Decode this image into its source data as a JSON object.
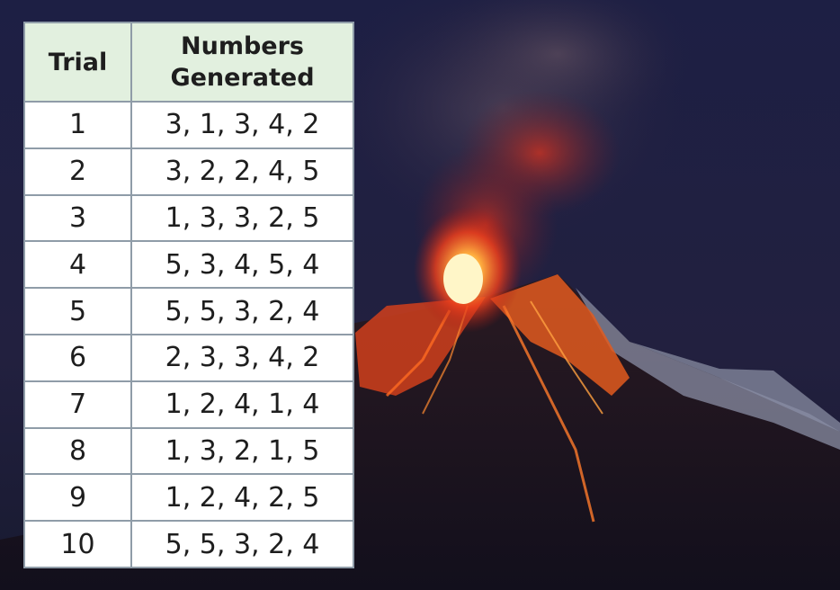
{
  "table": {
    "headers": [
      "Trial",
      "Numbers Generated"
    ],
    "rows": [
      {
        "trial": "1",
        "numbers": "3, 1, 3, 4, 2"
      },
      {
        "trial": "2",
        "numbers": "3, 2, 2, 4, 5"
      },
      {
        "trial": "3",
        "numbers": "1, 3, 3, 2, 5"
      },
      {
        "trial": "4",
        "numbers": "5, 3, 4, 5, 4"
      },
      {
        "trial": "5",
        "numbers": "5, 5, 3, 2, 4"
      },
      {
        "trial": "6",
        "numbers": "2, 3, 3, 4, 2"
      },
      {
        "trial": "7",
        "numbers": "1, 2, 4, 1, 4"
      },
      {
        "trial": "8",
        "numbers": "1, 3, 2, 1, 5"
      },
      {
        "trial": "9",
        "numbers": "1, 2, 4, 2, 5"
      },
      {
        "trial": "10",
        "numbers": "5, 5, 3, 2, 4"
      }
    ]
  },
  "colors": {
    "header_fill": "#e2f0df",
    "grid_line": "#8f9ca8",
    "night_sky": "#1b1d3d",
    "lava": "#ff5a1a"
  }
}
